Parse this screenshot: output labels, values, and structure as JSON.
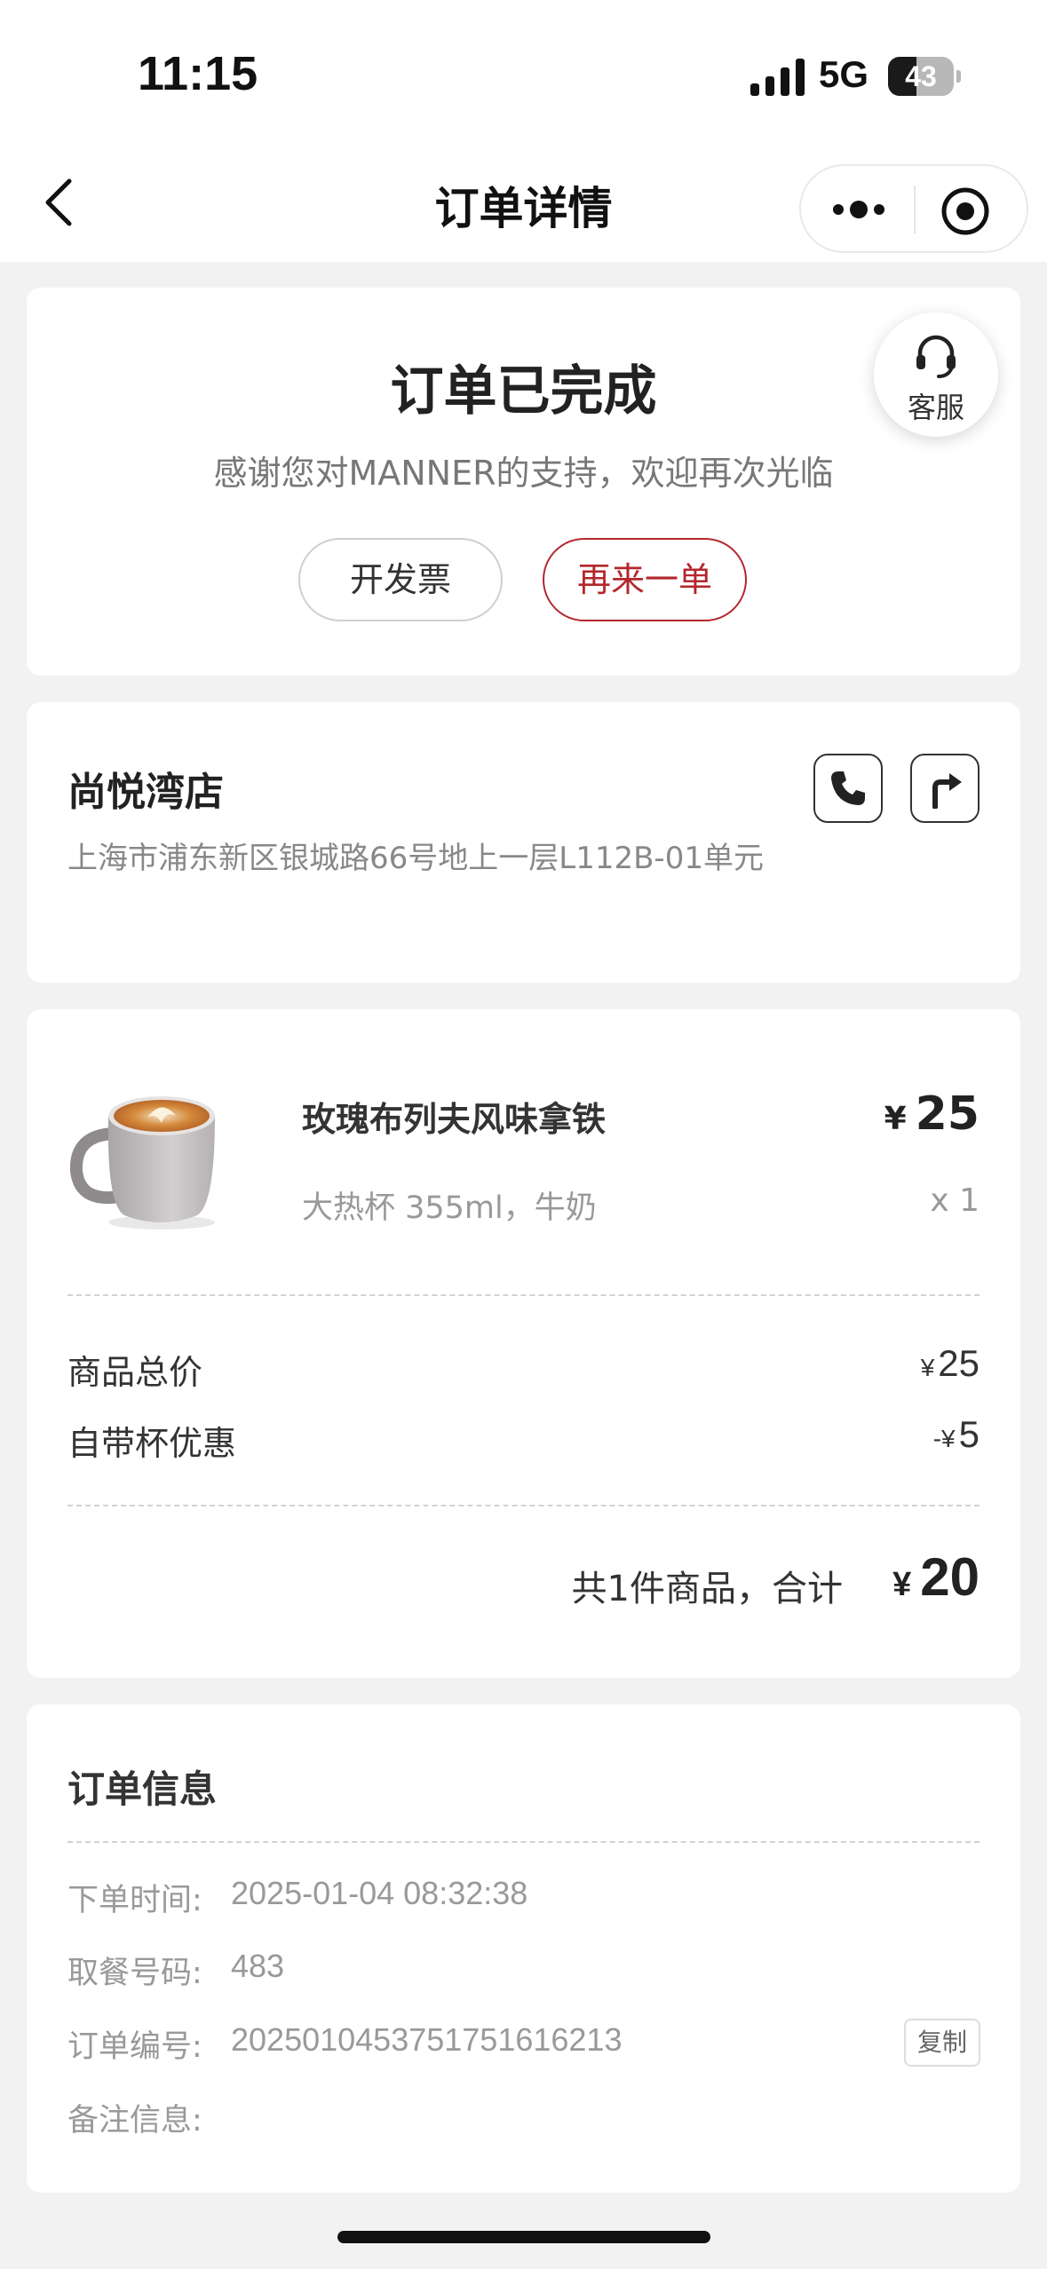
{
  "status_bar": {
    "time": "11:15",
    "network": "5G",
    "battery_level": "43",
    "battery_fraction": 0.43
  },
  "nav": {
    "title": "订单详情",
    "back_icon": "chevron-left-icon",
    "more_icon": "more-dots-icon",
    "close_icon": "target-circle-icon"
  },
  "order_status": {
    "title": "订单已完成",
    "subtitle": "感谢您对MANNER的支持，欢迎再次光临",
    "invoice_label": "开发票",
    "reorder_label": "再来一单",
    "service_label": "客服",
    "service_icon": "headset-icon",
    "accent_color": "#b3272c"
  },
  "store": {
    "name": "尚悦湾店",
    "address": "上海市浦东新区银城路66号地上一层L112B-01单元",
    "phone_icon": "phone-icon",
    "route_icon": "route-arrow-icon"
  },
  "items": [
    {
      "name": "玫瑰布列夫风味拿铁",
      "spec": "大热杯 355ml，牛奶",
      "currency": "¥",
      "price": "25",
      "qty": "x 1",
      "image": "latte-cup-image"
    }
  ],
  "pricing": {
    "subtotal_label": "商品总价",
    "subtotal_currency": "¥",
    "subtotal_value": "25",
    "discount_label": "自带杯优惠",
    "discount_prefix": "-¥",
    "discount_value": "5",
    "summary_text": "共1件商品，合计",
    "total_currency": "¥",
    "total_value": "20"
  },
  "order_info": {
    "title": "订单信息",
    "fields": [
      {
        "label": "下单时间:",
        "value": "2025-01-04 08:32:38"
      },
      {
        "label": "取餐号码:",
        "value": "483"
      },
      {
        "label": "订单编号:",
        "value": "20250104537517516162​13"
      },
      {
        "label": "备注信息:",
        "value": ""
      }
    ],
    "copy_label": "复制"
  }
}
